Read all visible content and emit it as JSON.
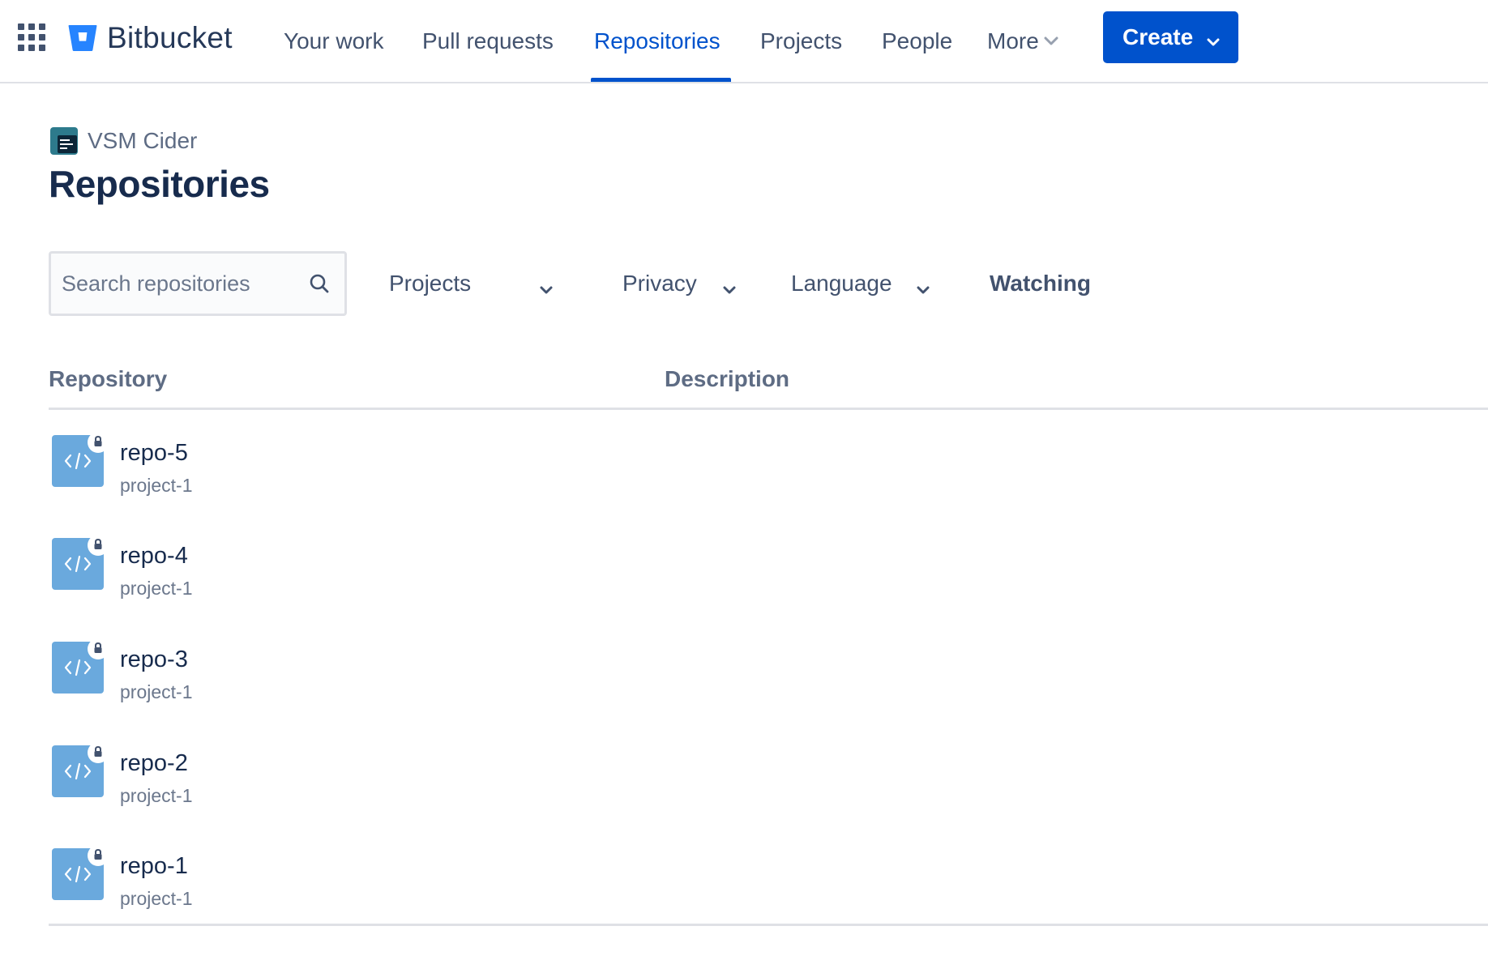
{
  "nav": {
    "app_switcher_icon": "grid-icon",
    "logo_text": "Bitbucket",
    "items": [
      {
        "label": "Your work"
      },
      {
        "label": "Pull requests"
      },
      {
        "label": "Repositories",
        "active": true
      },
      {
        "label": "Projects"
      },
      {
        "label": "People"
      },
      {
        "label": "More"
      }
    ],
    "create_label": "Create"
  },
  "header": {
    "workspace": "VSM Cider",
    "title": "Repositories"
  },
  "filters": {
    "search_placeholder": "Search repositories",
    "search_value": "",
    "projects_label": "Projects",
    "privacy_label": "Privacy",
    "language_label": "Language",
    "watching_label": "Watching"
  },
  "table": {
    "columns": [
      "Repository",
      "Description"
    ],
    "rows": [
      {
        "name": "repo-5",
        "project": "project-1",
        "description": "",
        "private": true
      },
      {
        "name": "repo-4",
        "project": "project-1",
        "description": "",
        "private": true
      },
      {
        "name": "repo-3",
        "project": "project-1",
        "description": "",
        "private": true
      },
      {
        "name": "repo-2",
        "project": "project-1",
        "description": "",
        "private": true
      },
      {
        "name": "repo-1",
        "project": "project-1",
        "description": "",
        "private": true
      }
    ]
  },
  "colors": {
    "brand": "#0052cc",
    "repo_avatar": "#6aa9dd",
    "workspace_avatar": "#2d7a8c",
    "text_primary": "#172b4d",
    "text_secondary": "#6b778c"
  }
}
